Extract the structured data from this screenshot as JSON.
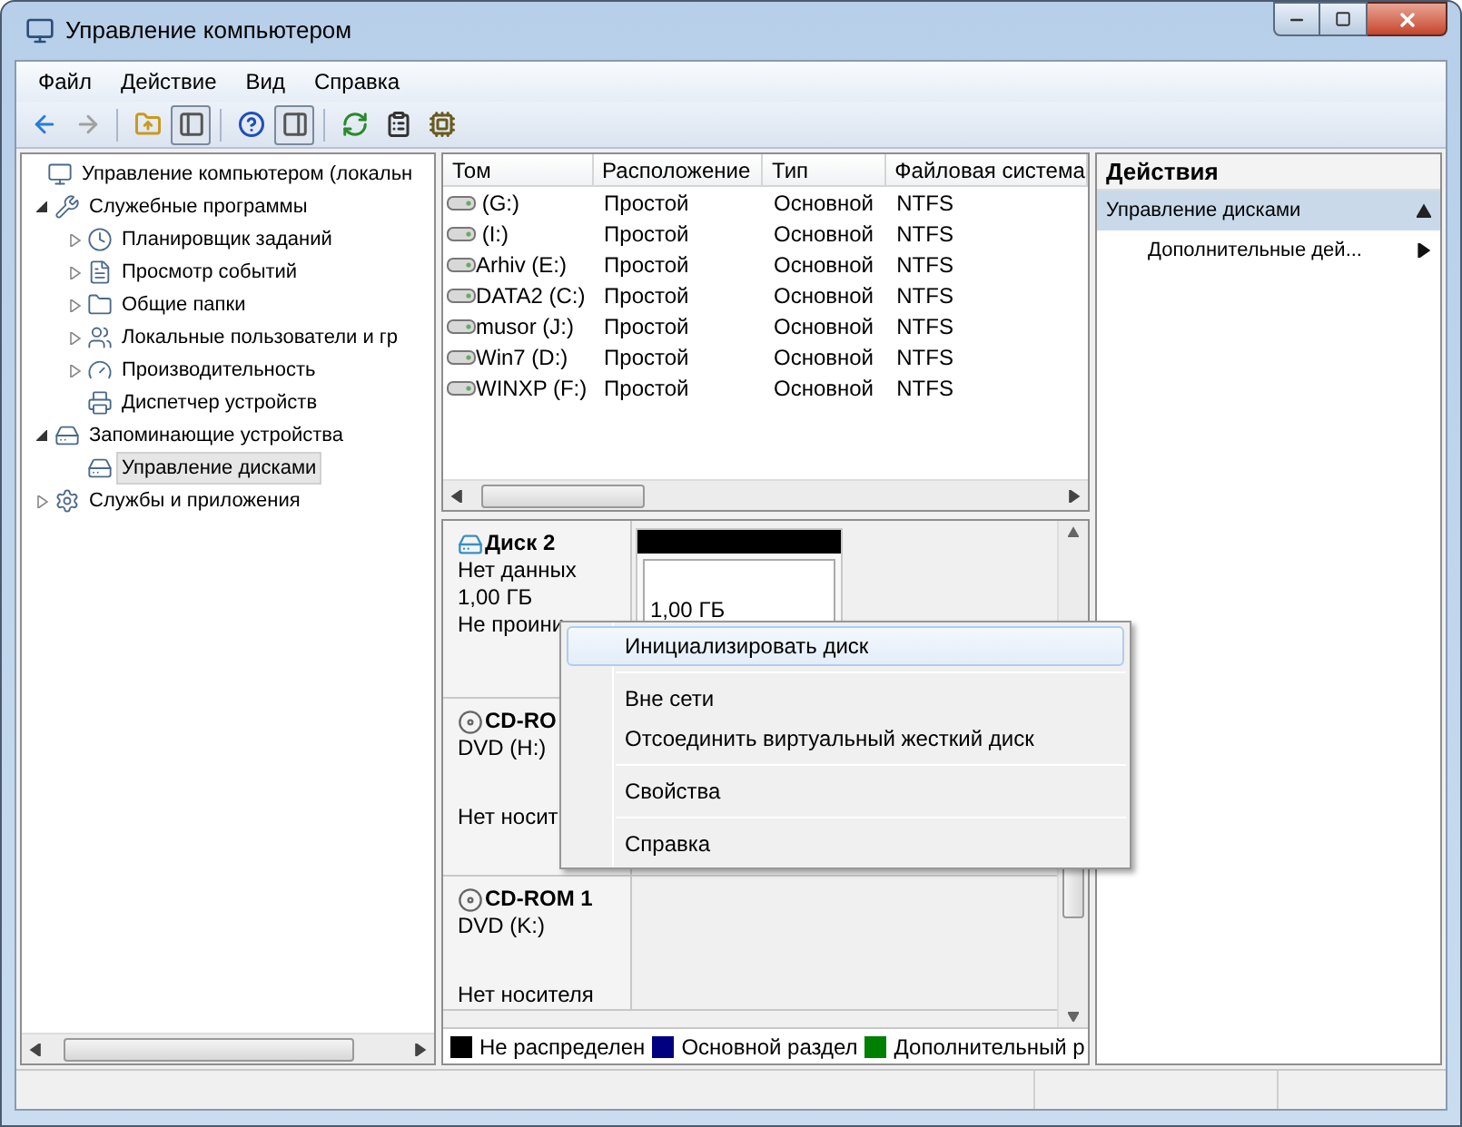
{
  "window": {
    "title": "Управление компьютером"
  },
  "menu": [
    "Файл",
    "Действие",
    "Вид",
    "Справка"
  ],
  "toolbar": [
    {
      "disabled": false,
      "pressed": false
    },
    {
      "disabled": true,
      "pressed": false
    },
    {
      "disabled": false,
      "pressed": false
    },
    {
      "disabled": false,
      "pressed": true
    },
    {
      "disabled": false,
      "pressed": false
    },
    {
      "disabled": false,
      "pressed": true
    },
    {
      "disabled": false,
      "pressed": false
    },
    {
      "disabled": false,
      "pressed": false
    },
    {
      "disabled": false,
      "pressed": false
    }
  ],
  "tree": [
    {
      "label": "Управление компьютером (локальн",
      "selected": false,
      "children": [
        {
          "label": "Служебные программы",
          "expanded": true,
          "selected": false,
          "children": [
            {
              "label": "Планировщик заданий",
              "expanded": false,
              "selected": false
            },
            {
              "label": "Просмотр событий",
              "expanded": false,
              "selected": false
            },
            {
              "label": "Общие папки",
              "expanded": false,
              "selected": false
            },
            {
              "label": "Локальные пользователи и гр",
              "expanded": false,
              "selected": false
            },
            {
              "label": "Производительность",
              "expanded": false,
              "selected": false
            },
            {
              "label": "Диспетчер устройств",
              "selected": false
            }
          ]
        },
        {
          "label": "Запоминающие устройства",
          "expanded": true,
          "selected": false,
          "children": [
            {
              "label": "Управление дисками",
              "selected": true
            }
          ]
        },
        {
          "label": "Службы и приложения",
          "expanded": false,
          "selected": false
        }
      ]
    }
  ],
  "table": {
    "columns": [
      "Том",
      "Расположение",
      "Тип",
      "Файловая система"
    ],
    "rows": [
      [
        " (G:)",
        "Простой",
        "Основной",
        "NTFS"
      ],
      [
        " (I:)",
        "Простой",
        "Основной",
        "NTFS"
      ],
      [
        "Arhiv (E:)",
        "Простой",
        "Основной",
        "NTFS"
      ],
      [
        "DATA2 (C:)",
        "Простой",
        "Основной",
        "NTFS"
      ],
      [
        "musor (J:)",
        "Простой",
        "Основной",
        "NTFS"
      ],
      [
        "Win7 (D:)",
        "Простой",
        "Основной",
        "NTFS"
      ],
      [
        "WINXP (F:)",
        "Простой",
        "Основной",
        "NTFS"
      ]
    ]
  },
  "disks": [
    {
      "kind": "disk",
      "name": "Диск 2",
      "info": [
        "Нет данных",
        "1,00 ГБ",
        "Не проини"
      ],
      "partition": {
        "size": "1,00 ГБ",
        "color": "#000000"
      }
    },
    {
      "kind": "cdrom",
      "name": "CD-RO",
      "drive": "DVD (H:)",
      "media": "Нет носит"
    },
    {
      "kind": "cdrom",
      "name": "CD-ROM 1",
      "drive": "DVD (K:)",
      "media": "Нет носителя"
    }
  ],
  "legend": [
    {
      "label": "Не распределен",
      "color": "#000000"
    },
    {
      "label": "Основной раздел",
      "color": "#000080"
    },
    {
      "label": "Дополнительный р",
      "color": "#008000"
    }
  ],
  "actions": {
    "title": "Действия",
    "section": "Управление дисками",
    "expanded": true,
    "items": [
      "Дополнительные дей..."
    ]
  },
  "context_menu": {
    "groups": [
      [
        {
          "label": "Инициализировать диск",
          "selected": true
        }
      ],
      [
        {
          "label": "Вне сети",
          "selected": false
        },
        {
          "label": "Отсоединить виртуальный жесткий диск",
          "selected": false
        }
      ],
      [
        {
          "label": "Свойства",
          "selected": false
        }
      ],
      [
        {
          "label": "Справка",
          "selected": false
        }
      ]
    ]
  }
}
